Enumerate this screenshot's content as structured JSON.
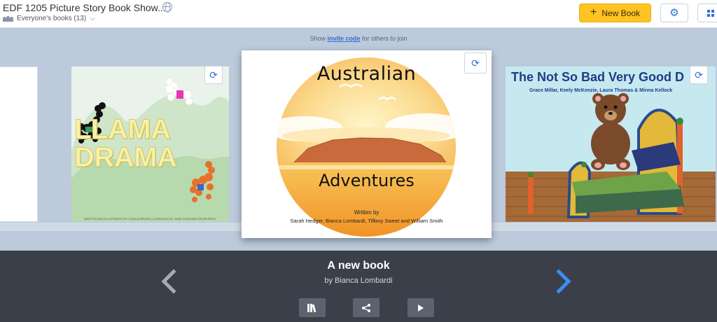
{
  "header": {
    "title": "EDF 1205 Picture Story Book Show...",
    "library_label": "Everyone's books (13)",
    "new_book_label": "New Book"
  },
  "stage": {
    "invite_prefix": "Show",
    "invite_link": "invite code",
    "invite_suffix": "for others to join"
  },
  "books": {
    "llama": {
      "title_line1": "LLAMA",
      "title_line2": "DRAMA",
      "credit": "WRITTEN AND ILLUSTRATED BY JOSHUA BROWN, LAURA MILTON, ZANE ZHAN AND KRUPA PATEL"
    },
    "australian": {
      "title_line1": "Australian",
      "title_line2": "Adventures",
      "written_by": "Written by",
      "authors": "Sarah Hedger, Bianca Lombardi, Tiffany Sweet and William Smith"
    },
    "teddy": {
      "title": "The Not So Bad Very Good D",
      "authors": "Grace Millar, Keely McKenzie, Laura Thomas & Minna Kellock"
    }
  },
  "current": {
    "title": "A new book",
    "author": "by Bianca Lombardi"
  },
  "colors": {
    "accent": "#2f6fd6",
    "new_book": "#ffc325",
    "stage_bg": "#bccadb",
    "bottom_bar": "#3b3f4a"
  },
  "icons": [
    "globe-icon",
    "people-icon",
    "chevron-down-icon",
    "plus-icon",
    "gear-icon",
    "grid-icon",
    "cycle-icon",
    "chevron-left-icon",
    "chevron-right-icon",
    "library-icon",
    "share-icon",
    "play-icon"
  ]
}
